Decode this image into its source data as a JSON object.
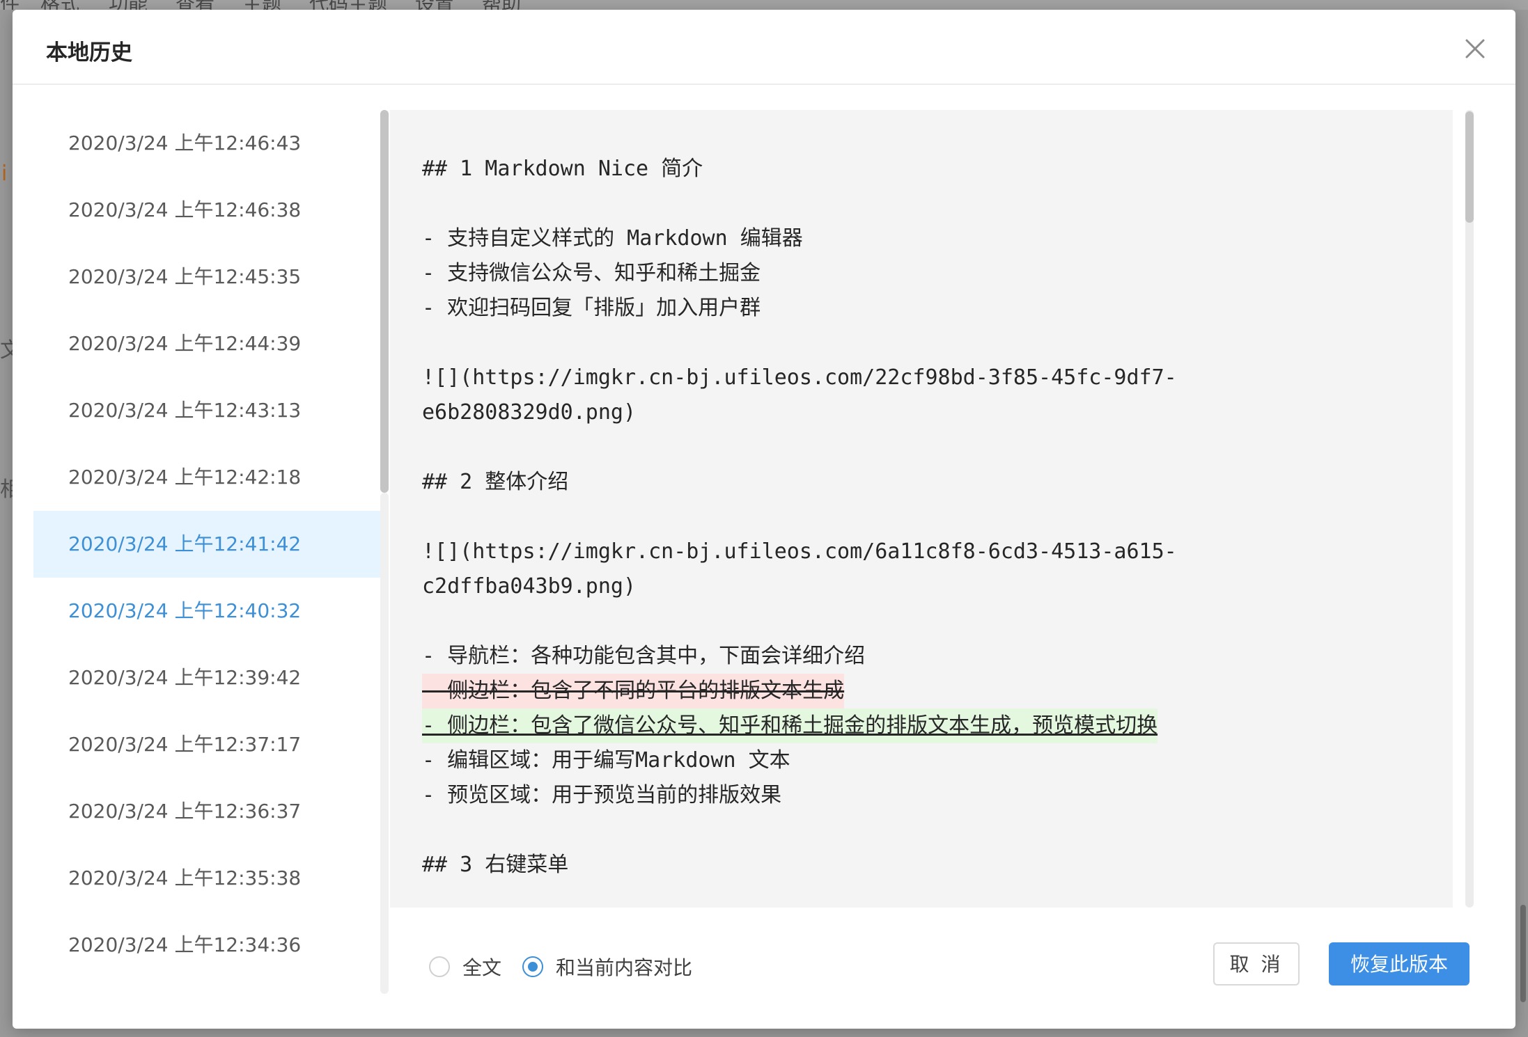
{
  "background": {
    "menu": [
      "件",
      "格式",
      "功能",
      "查看",
      "主题",
      "代码主题",
      "设置",
      "帮助"
    ],
    "side_glyphs": [
      "i",
      "文",
      "相"
    ]
  },
  "modal": {
    "title": "本地历史",
    "history": [
      "2020/3/24 上午12:46:43",
      "2020/3/24 上午12:46:38",
      "2020/3/24 上午12:45:35",
      "2020/3/24 上午12:44:39",
      "2020/3/24 上午12:43:13",
      "2020/3/24 上午12:42:18",
      "2020/3/24 上午12:41:42",
      "2020/3/24 上午12:40:32",
      "2020/3/24 上午12:39:42",
      "2020/3/24 上午12:37:17",
      "2020/3/24 上午12:36:37",
      "2020/3/24 上午12:35:38",
      "2020/3/24 上午12:34:36"
    ],
    "selected_index": 6,
    "hover_index": 7,
    "content_lines": [
      {
        "text": "## 1 Markdown Nice 简介",
        "diff": "none"
      },
      {
        "text": "",
        "diff": "none"
      },
      {
        "text": "- 支持自定义样式的 Markdown 编辑器",
        "diff": "none"
      },
      {
        "text": "- 支持微信公众号、知乎和稀土掘金",
        "diff": "none"
      },
      {
        "text": "- 欢迎扫码回复「排版」加入用户群",
        "diff": "none"
      },
      {
        "text": "",
        "diff": "none"
      },
      {
        "text": "![](https://imgkr.cn-bj.ufileos.com/22cf98bd-3f85-45fc-9df7-",
        "diff": "none"
      },
      {
        "text": "e6b2808329d0.png)",
        "diff": "none"
      },
      {
        "text": "",
        "diff": "none"
      },
      {
        "text": "## 2 整体介绍",
        "diff": "none"
      },
      {
        "text": "",
        "diff": "none"
      },
      {
        "text": "![](https://imgkr.cn-bj.ufileos.com/6a11c8f8-6cd3-4513-a615-",
        "diff": "none"
      },
      {
        "text": "c2dffba043b9.png)",
        "diff": "none"
      },
      {
        "text": "",
        "diff": "none"
      },
      {
        "text": "- 导航栏：各种功能包含其中，下面会详细介绍",
        "diff": "none"
      },
      {
        "text": "- 侧边栏：包含了不同的平台的排版文本生成",
        "diff": "removed"
      },
      {
        "text": "- 侧边栏：包含了微信公众号、知乎和稀土掘金的排版文本生成，预览模式切换",
        "diff": "added"
      },
      {
        "text": "- 编辑区域：用于编写Markdown 文本",
        "diff": "none"
      },
      {
        "text": "- 预览区域：用于预览当前的排版效果",
        "diff": "none"
      },
      {
        "text": "",
        "diff": "none"
      },
      {
        "text": "## 3 右键菜单",
        "diff": "none"
      }
    ],
    "view_mode": {
      "options": [
        "全文",
        "和当前内容对比"
      ],
      "selected": 1
    },
    "buttons": {
      "cancel": "取 消",
      "restore": "恢复此版本"
    },
    "colors": {
      "accent": "#3d8fe6",
      "selected_bg": "#e6f4ff",
      "removed_bg": "#fde2e2",
      "added_bg": "#e4f8e0"
    }
  }
}
